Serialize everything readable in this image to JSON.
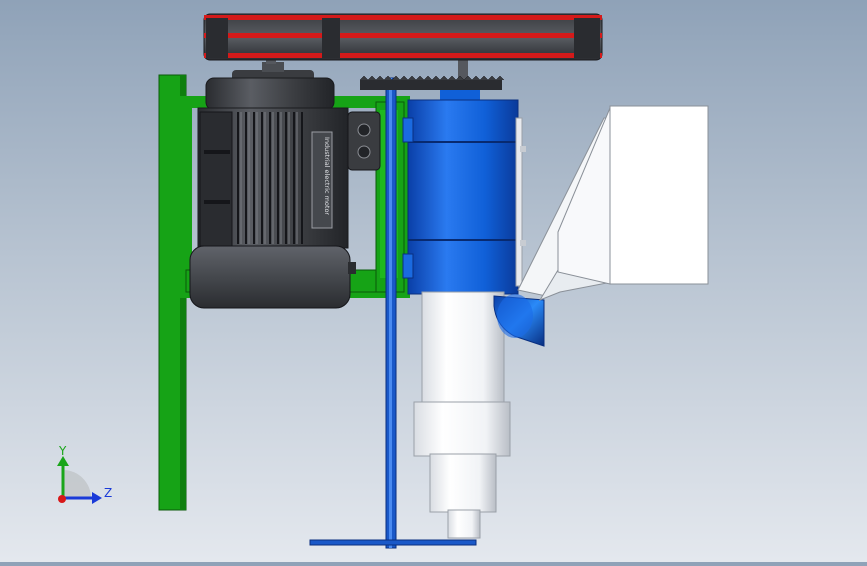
{
  "triad": {
    "y_label": "Y",
    "z_label": "Z",
    "colors": {
      "y_axis": "#1aa51a",
      "z_axis": "#1a3ad8",
      "origin": "#d81818"
    }
  },
  "motor": {
    "nameplate_text": "Industrial electric motor"
  },
  "colors": {
    "frame_green": "#16a316",
    "housing_blue": "#1060d8",
    "belt_red": "#d41a1a",
    "motor_dark": "#3a3c40",
    "shaft_blue": "#1a58c8",
    "hopper_white": "#ffffff"
  }
}
